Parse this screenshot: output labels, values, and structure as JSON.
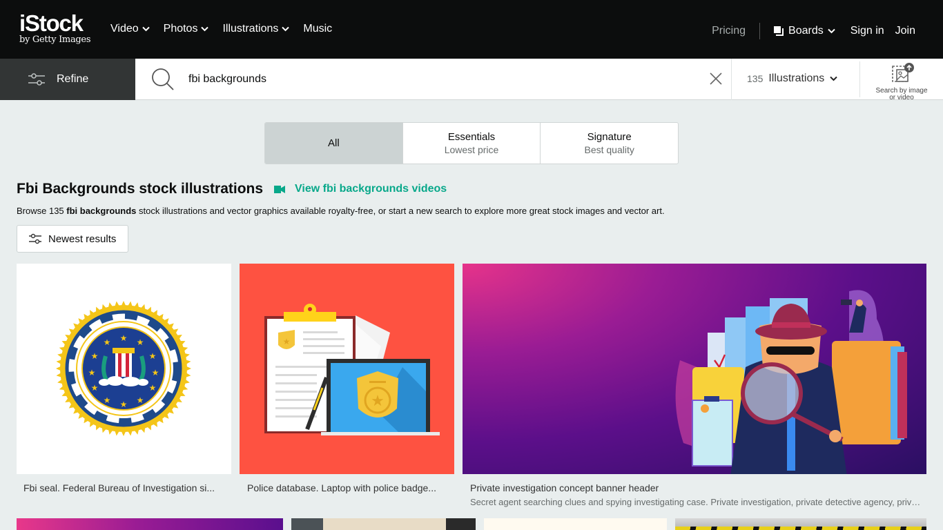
{
  "header": {
    "logo_main": "iStock",
    "logo_sub": "by Getty Images",
    "nav": [
      {
        "label": "Video",
        "has_dropdown": true
      },
      {
        "label": "Photos",
        "has_dropdown": true
      },
      {
        "label": "Illustrations",
        "has_dropdown": true
      },
      {
        "label": "Music",
        "has_dropdown": false
      }
    ],
    "pricing": "Pricing",
    "boards": "Boards",
    "sign_in": "Sign in",
    "join": "Join"
  },
  "search": {
    "refine_label": "Refine",
    "query": "fbi backgrounds",
    "result_count": "135",
    "asset_type": "Illustrations",
    "image_search_label_line1": "Search by image",
    "image_search_label_line2": "or video"
  },
  "segments": [
    {
      "title": "All",
      "subtitle": "",
      "active": true
    },
    {
      "title": "Essentials",
      "subtitle": "Lowest price",
      "active": false
    },
    {
      "title": "Signature",
      "subtitle": "Best quality",
      "active": false
    }
  ],
  "results_header": {
    "title": "Fbi Backgrounds stock illustrations",
    "video_link": "View fbi backgrounds videos",
    "browse_prefix": "Browse 135 ",
    "browse_bold": "fbi backgrounds",
    "browse_suffix": " stock illustrations and vector graphics available royalty-free, or start a new search to explore more great stock images and vector art.",
    "sort_label": "Newest results"
  },
  "results": [
    {
      "caption": "Fbi seal. Federal Bureau of Investigation si...",
      "description": ""
    },
    {
      "caption": "Police database. Laptop with police badge...",
      "description": ""
    },
    {
      "caption": "Private investigation concept banner header",
      "description": "Secret agent searching clues and spying investigating case. Private investigation, private detective agency, priva..."
    }
  ],
  "colors": {
    "accent": "#08a88a",
    "nav_bg": "#0c0d0d",
    "refine_bg": "#323535",
    "page_bg": "#e9eeee"
  }
}
